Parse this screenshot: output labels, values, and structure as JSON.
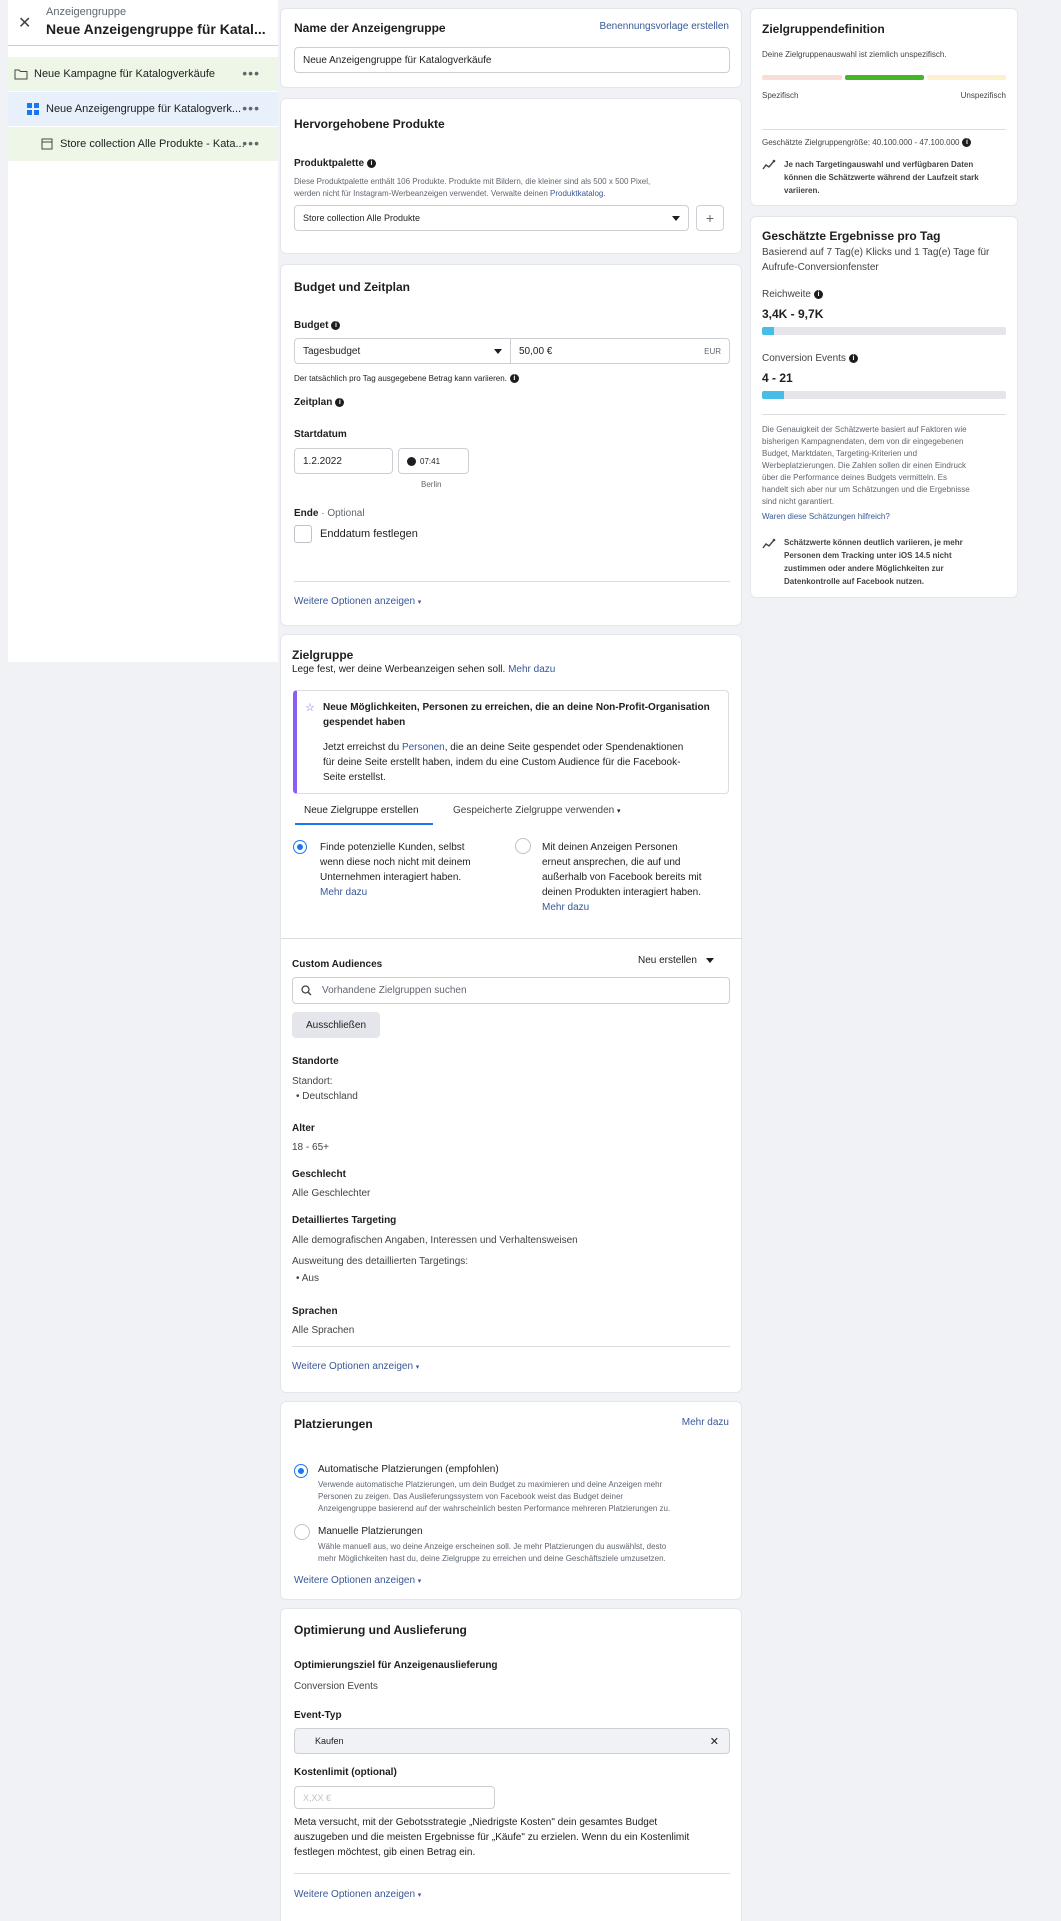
{
  "sidebar": {
    "small_title": "Anzeigengruppe",
    "title": "Neue Anzeigengruppe für Katal...",
    "campaign": "Neue Kampagne für Katalogverkäufe",
    "adset": "Neue Anzeigengruppe für Katalogverk...",
    "ad": "Store collection Alle Produkte - Kata...",
    "more": "•••"
  },
  "name_section": {
    "title": "Name der Anzeigengruppe",
    "link": "Benennungsvorlage erstellen",
    "value": "Neue Anzeigengruppe für Katalogverkäufe"
  },
  "products": {
    "title": "Hervorgehobene Produkte",
    "palette_label": "Produktpalette",
    "description_1": "Diese Produktpalette enthält 106 Produkte. Produkte mit Bildern, die kleiner sind als 500 x 500 Pixel,",
    "description_2": "werden nicht für Instagram-Werbeanzeigen verwendet. Verwalte deinen",
    "catalog_link": "Produktkatalog.",
    "selected": "Store collection Alle Produkte",
    "add": "+"
  },
  "budget": {
    "title": "Budget und Zeitplan",
    "budget_label": "Budget",
    "type": "Tagesbudget",
    "amount": "50,00 €",
    "currency": "EUR",
    "note": "Der tatsächlich pro Tag ausgegebene Betrag kann variieren.",
    "schedule_label": "Zeitplan",
    "start_label": "Startdatum",
    "start_date": "1.2.2022",
    "start_time": "07:41",
    "timezone": "Berlin",
    "end_label": "Ende",
    "end_optional": "· Optional",
    "end_checkbox": "Enddatum festlegen",
    "more": "Weitere Optionen anzeigen"
  },
  "audience": {
    "title": "Zielgruppe",
    "subtitle": "Lege fest, wer deine Werbeanzeigen sehen soll.",
    "subtitle_link": "Mehr dazu",
    "notice_title_1": "Neue Möglichkeiten, Personen zu erreichen, die an deine Non-Profit-Organisation",
    "notice_title_2": "gespendet haben",
    "notice_1a": "Jetzt erreichst du",
    "notice_1_link": "Personen",
    "notice_1b": ", die an deine Seite gespendet oder Spendenaktionen",
    "notice_2": "für deine Seite erstellt haben, indem du eine Custom Audience für die Facebook-",
    "notice_3": "Seite erstellst.",
    "tab_new": "Neue Zielgruppe erstellen",
    "tab_saved": "Gespeicherte Zielgruppe verwenden",
    "opt1_1": "Finde potenzielle Kunden, selbst",
    "opt1_2": "wenn diese noch nicht mit deinem",
    "opt1_3": "Unternehmen interagiert haben.",
    "opt1_link": "Mehr dazu",
    "opt2_1": "Mit deinen Anzeigen Personen",
    "opt2_2": "erneut ansprechen, die auf und",
    "opt2_3": "außerhalb von Facebook bereits mit",
    "opt2_4": "deinen Produkten interagiert haben.",
    "opt2_link": "Mehr dazu",
    "custom_label": "Custom Audiences",
    "create_new": "Neu erstellen",
    "search_placeholder": "Vorhandene Zielgruppen suchen",
    "exclude": "Ausschließen",
    "locations_label": "Standorte",
    "location_sub": "Standort:",
    "location_value": "• Deutschland",
    "age_label": "Alter",
    "age_value": "18 - 65+",
    "gender_label": "Geschlecht",
    "gender_value": "Alle Geschlechter",
    "targeting_label": "Detailliertes Targeting",
    "targeting_value": "Alle demografischen Angaben, Interessen und Verhaltensweisen",
    "expansion_label": "Ausweitung des detaillierten Targetings:",
    "expansion_value": "• Aus",
    "languages_label": "Sprachen",
    "languages_value": "Alle Sprachen",
    "more": "Weitere Optionen anzeigen"
  },
  "placements": {
    "title": "Platzierungen",
    "link": "Mehr dazu",
    "auto_title": "Automatische Platzierungen (empfohlen)",
    "auto_1": "Verwende automatische Platzierungen, um dein Budget zu maximieren und deine Anzeigen mehr",
    "auto_2": "Personen zu zeigen. Das Auslieferungssystem von Facebook weist das Budget deiner",
    "auto_3": "Anzeigengruppe basierend auf der wahrscheinlich besten Performance mehreren Platzierungen zu.",
    "manual_title": "Manuelle Platzierungen",
    "manual_1": "Wähle manuell aus, wo deine Anzeige erscheinen soll. Je mehr Platzierungen du auswählst, desto",
    "manual_2": "mehr Möglichkeiten hast du, deine Zielgruppe zu erreichen und deine Geschäftsziele umzusetzen.",
    "more": "Weitere Optionen anzeigen"
  },
  "optimization": {
    "title": "Optimierung und Auslieferung",
    "goal_label": "Optimierungsziel für Anzeigenauslieferung",
    "goal_value": "Conversion Events",
    "event_label": "Event-Typ",
    "event_value": "Kaufen",
    "cost_label": "Kostenlimit (optional)",
    "cost_placeholder": "X,XX €",
    "note_1": "Meta versucht, mit der Gebotsstrategie „Niedrigste Kosten\" dein gesamtes Budget",
    "note_2": "auszugeben und die meisten Ergebnisse für „Käufe\" zu erzielen. Wenn du ein Kostenlimit",
    "note_3": "festlegen möchtest, gib einen Betrag ein.",
    "more": "Weitere Optionen anzeigen"
  },
  "definition": {
    "title": "Zielgruppendefinition",
    "subtitle": "Deine Zielgruppenauswahl ist ziemlich unspezifisch.",
    "left": "Spezifisch",
    "right": "Unspezifisch",
    "size": "Geschätzte Zielgruppengröße: 40.100.000 - 47.100.000",
    "note_1": "Je nach Targetingauswahl und verfügbaren Daten",
    "note_2": "können die Schätzwerte während der Laufzeit stark",
    "note_3": "variieren."
  },
  "results": {
    "title": "Geschätzte Ergebnisse pro Tag",
    "subtitle_1": "Basierend auf 7 Tag(e) Klicks und 1 Tag(e) Tage für",
    "subtitle_2": "Aufrufe-Conversionfenster",
    "reach_label": "Reichweite",
    "reach_value": "3,4K - 9,7K",
    "reach_fraction": 0.05,
    "conv_label": "Conversion Events",
    "conv_value": "4 - 21",
    "conv_fraction": 0.09,
    "p1": "Die Genauigkeit der Schätzwerte basiert auf Faktoren wie",
    "p2": "bisherigen Kampagnendaten, dem von dir eingegebenen",
    "p3": "Budget, Marktdaten, Targeting-Kriterien und",
    "p4": "Werbeplatzierungen. Die Zahlen sollen dir einen Eindruck",
    "p5": "über die Performance deines Budgets vermitteln. Es",
    "p6": "handelt sich aber nur um Schätzungen und die Ergebnisse",
    "p7": "sind nicht garantiert.",
    "helpful_link": "Waren diese Schätzungen hilfreich?",
    "warn_1": "Schätzwerte können deutlich variieren, je mehr",
    "warn_2": "Personen dem Tracking unter iOS 14.5 nicht",
    "warn_3": "zustimmen oder andere Möglichkeiten zur",
    "warn_4": "Datenkontrolle auf Facebook nutzen."
  }
}
